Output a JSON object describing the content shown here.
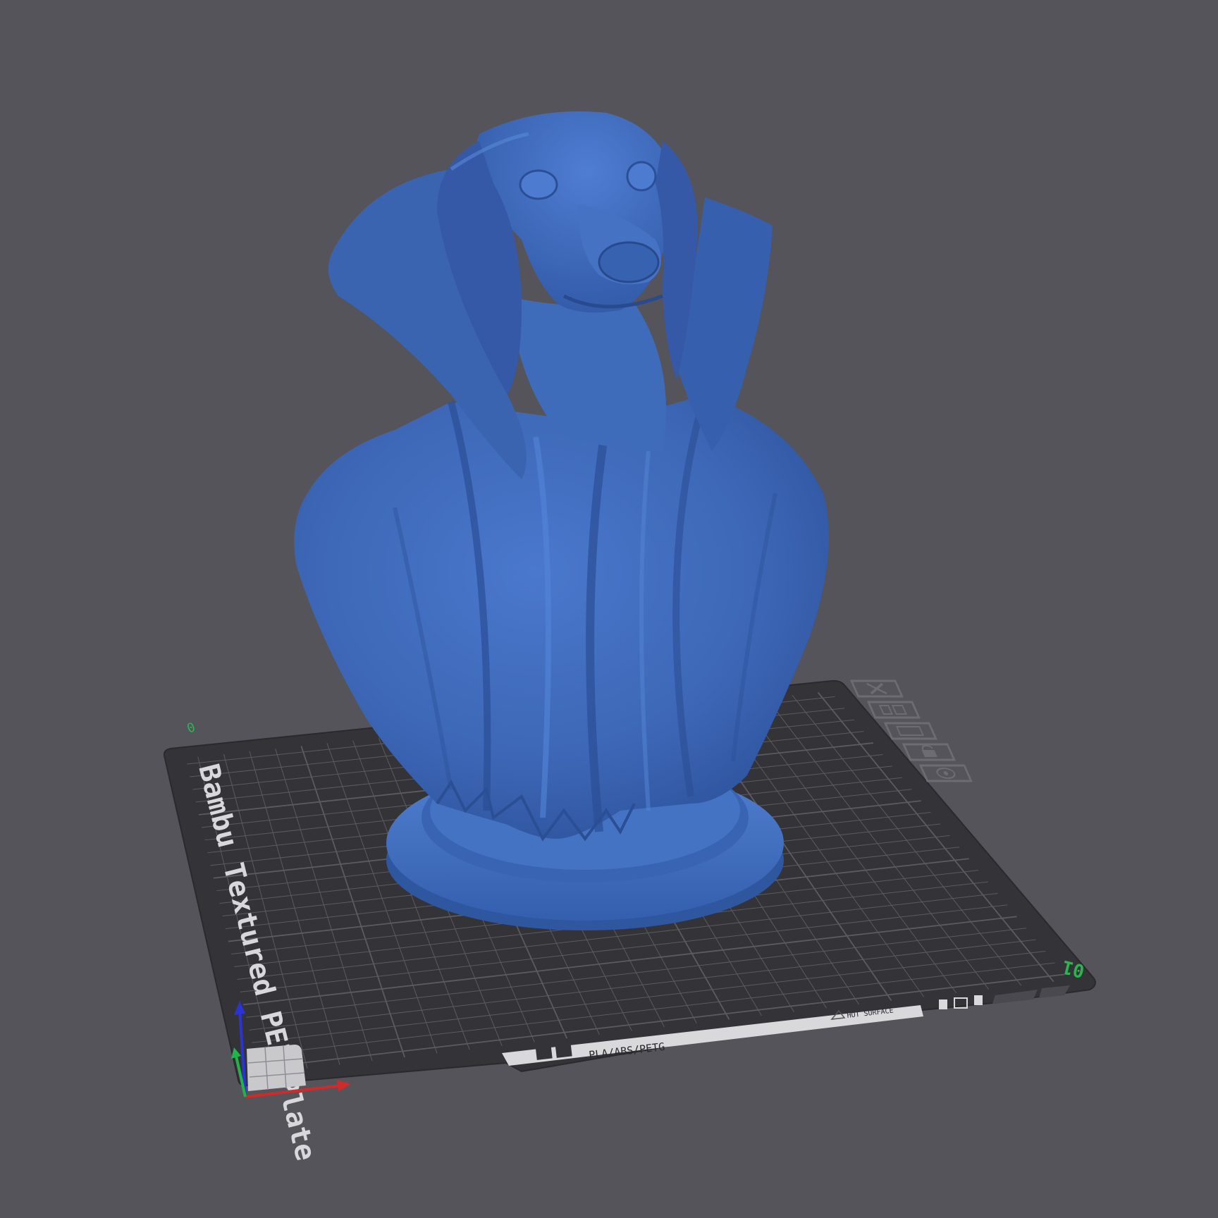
{
  "viewport": {
    "background": "#55545a",
    "model_color": "#3d67b6"
  },
  "plate": {
    "name": "Bambu Textured PEI Plate",
    "material_label": "PLA/ABS/PETG",
    "hot_surface_label": "HOT SURFACE",
    "plate_index": "01",
    "corner_mark": "0",
    "surface_color": "#343338",
    "grid_color": "#5c5b61"
  },
  "plate_toolbar": {
    "buttons": [
      {
        "name": "delete-plate-icon"
      },
      {
        "name": "auto-arrange-icon"
      },
      {
        "name": "orient-plate-icon"
      },
      {
        "name": "lock-plate-icon"
      },
      {
        "name": "plate-settings-icon"
      }
    ]
  },
  "axes": {
    "x_color": "#d22a2a",
    "y_color": "#22b34a",
    "z_color": "#2a34d6"
  }
}
